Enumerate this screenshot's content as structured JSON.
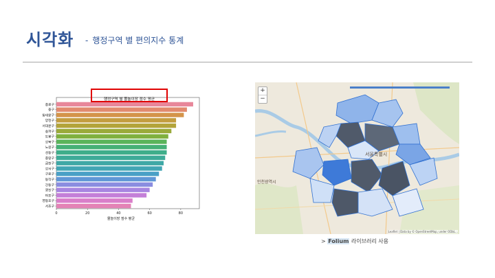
{
  "header": {
    "title": "시각화",
    "dash": "-",
    "subtitle": "행정구역 별 편의지수 통계"
  },
  "chart_data": {
    "type": "bar",
    "orientation": "horizontal",
    "title": "행정구역 별 몰놀이장 점수 평균",
    "xlabel": "몰놀이장 점수 평균",
    "ylabel": "",
    "xlim": [
      0,
      92
    ],
    "xticks": [
      0,
      20,
      40,
      60,
      80
    ],
    "categories": [
      "종로구",
      "중구",
      "동대문구",
      "양천구",
      "서대문구",
      "송파구",
      "도봉구",
      "강북구",
      "노원구",
      "성동구",
      "종랑구",
      "금천구",
      "강서구",
      "구로구",
      "동작구",
      "강동구",
      "광진구",
      "마포구",
      "영등포구",
      "서초구"
    ],
    "values": [
      88,
      84,
      82,
      77,
      77,
      74,
      72,
      71,
      71,
      71,
      70,
      69,
      68,
      66,
      64,
      62,
      60,
      58,
      49,
      48
    ],
    "colors": [
      "#e8879a",
      "#e28a6e",
      "#d4944a",
      "#c39d3f",
      "#b3a43a",
      "#9aaa3a",
      "#7fb03e",
      "#5ab45a",
      "#45b076",
      "#3fae8a",
      "#3eab98",
      "#3fa8a6",
      "#41a5b4",
      "#4aa0c6",
      "#6097d6",
      "#8a8de0",
      "#a886e0",
      "#c47fd8",
      "#d97ec9",
      "#e482b6"
    ]
  },
  "map": {
    "zoom_in": "+",
    "zoom_out": "−",
    "attribution": "Leaflet | Data by © OpenStreetMap, under ODbL...",
    "labels": [
      "서울특별시",
      "인천광역시"
    ]
  },
  "caption": {
    "prefix": "> ",
    "highlight": "Folium",
    "text": " 라이브러리 사용"
  }
}
